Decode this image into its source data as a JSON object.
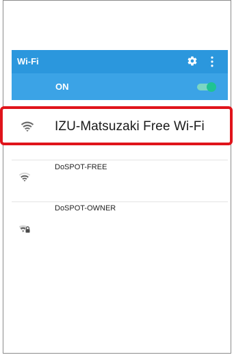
{
  "appbar": {
    "title": "Wi-Fi",
    "settings_icon": "gear-icon",
    "more_icon": "more-vert-icon",
    "color": "#2b97dd"
  },
  "wifi_toggle": {
    "label": "ON",
    "state": "on",
    "color": "#1fc393"
  },
  "networks": [
    {
      "name": "IZU-Matsuzaki Free Wi-Fi",
      "secured": false,
      "highlighted": true,
      "icon": "wifi-icon"
    },
    {
      "name": "DoSPOT-FREE",
      "secured": false,
      "highlighted": false,
      "icon": "wifi-icon"
    },
    {
      "name": "DoSPOT-OWNER",
      "secured": true,
      "highlighted": false,
      "icon": "wifi-lock-icon"
    }
  ],
  "highlight_color": "#e0141b"
}
